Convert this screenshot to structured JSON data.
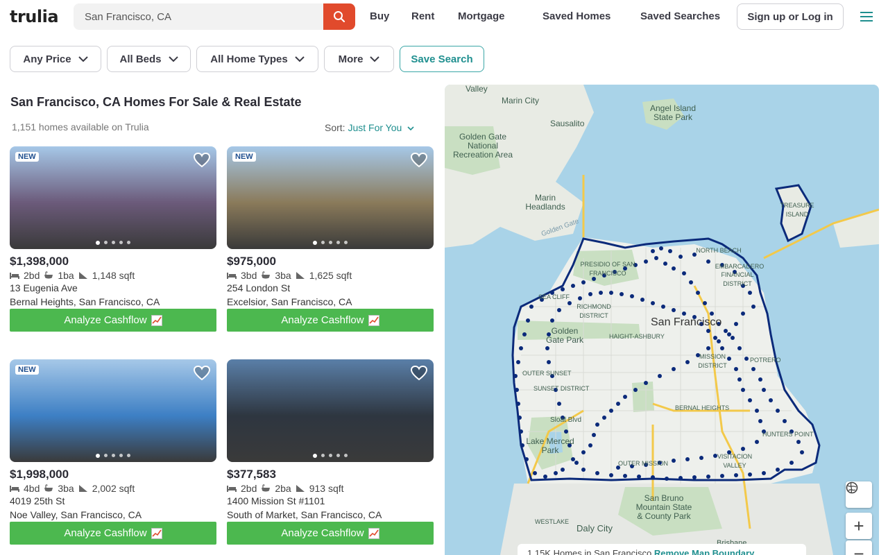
{
  "header": {
    "logo": "trulia",
    "search_value": "San Francisco, CA",
    "nav": [
      "Buy",
      "Rent",
      "Mortgage",
      "Saved Homes",
      "Saved Searches"
    ],
    "login": "Sign up or Log in"
  },
  "filters": {
    "price": "Any Price",
    "beds": "All Beds",
    "types": "All Home Types",
    "more": "More",
    "save": "Save Search"
  },
  "results": {
    "title": "San Francisco, CA Homes For Sale & Real Estate",
    "count": "1,151 homes available on Trulia",
    "sort_label": "Sort:",
    "sort_value": "Just For You"
  },
  "listings": [
    {
      "badge": "NEW",
      "price": "$1,398,000",
      "beds": "2bd",
      "baths": "1ba",
      "sqft": "1,148 sqft",
      "address": "13 Eugenia Ave",
      "hood": "Bernal Heights, San Francisco, CA",
      "cta": "Analyze Cashflow",
      "photo_color": "#6b5a7a"
    },
    {
      "badge": "NEW",
      "price": "$975,000",
      "beds": "3bd",
      "baths": "3ba",
      "sqft": "1,625 sqft",
      "address": "254 London St",
      "hood": "Excelsior, San Francisco, CA",
      "cta": "Analyze Cashflow",
      "photo_color": "#8a7a5a"
    },
    {
      "badge": "NEW",
      "price": "$1,998,000",
      "beds": "4bd",
      "baths": "3ba",
      "sqft": "2,002 sqft",
      "address": "4019 25th St",
      "hood": "Noe Valley, San Francisco, CA",
      "cta": "Analyze Cashflow",
      "photo_color": "#3d7fc4"
    },
    {
      "badge": "",
      "price": "$377,583",
      "beds": "2bd",
      "baths": "2ba",
      "sqft": "913 sqft",
      "address": "1400 Mission St #1101",
      "hood": "South of Market, San Francisco, CA",
      "cta": "Analyze Cashflow",
      "photo_color": "#2e3640"
    }
  ],
  "map": {
    "labels": {
      "valley": "Valley",
      "marin_city": "Marin City",
      "sausalito": "Sausalito",
      "angel_island": "Angel Island State Park",
      "golden_gate_nra": "Golden Gate National Recreation Area",
      "marin_headlands": "Marin Headlands",
      "treasure_island": "TREASURE ISLAND",
      "presidio": "PRESIDIO OF SAN FRANCISCO",
      "north_beach": "NORTH BEACH",
      "embarcadero": "EMBARCADERO",
      "financial": "FINANCIAL DISTRICT",
      "sea_cliff": "SEA CLIFF",
      "richmond": "RICHMOND DISTRICT",
      "san_francisco": "San Francisco",
      "ggpark": "Golden Gate Park",
      "haight": "HAIGHT-ASHBURY",
      "mission": "MISSION DISTRICT",
      "potrero": "POTRERO",
      "outer_sunset": "OUTER SUNSET",
      "sunset": "SUNSET DISTRICT",
      "sloat": "Sloat Blvd",
      "bernal": "BERNAL HEIGHTS",
      "lake_merced": "Lake Merced Park",
      "hunters_point": "HUNTERS POINT",
      "visitacion": "VISITACION VALLEY",
      "outer_mission": "OUTER MISSION",
      "san_bruno": "San Bruno Mountain State & County Park",
      "westlake": "WESTLAKE",
      "daly_city": "Daly City",
      "brisbane": "Brisbane",
      "golden_gate": "Golden Gate"
    },
    "zoom_in": "+",
    "zoom_out": "−",
    "footer_count": "1.15K Homes in San Francisco",
    "footer_action": "Remove Map Boundary",
    "pin_color": "#0b2a7a",
    "boundary_color": "#0b2a7a"
  }
}
